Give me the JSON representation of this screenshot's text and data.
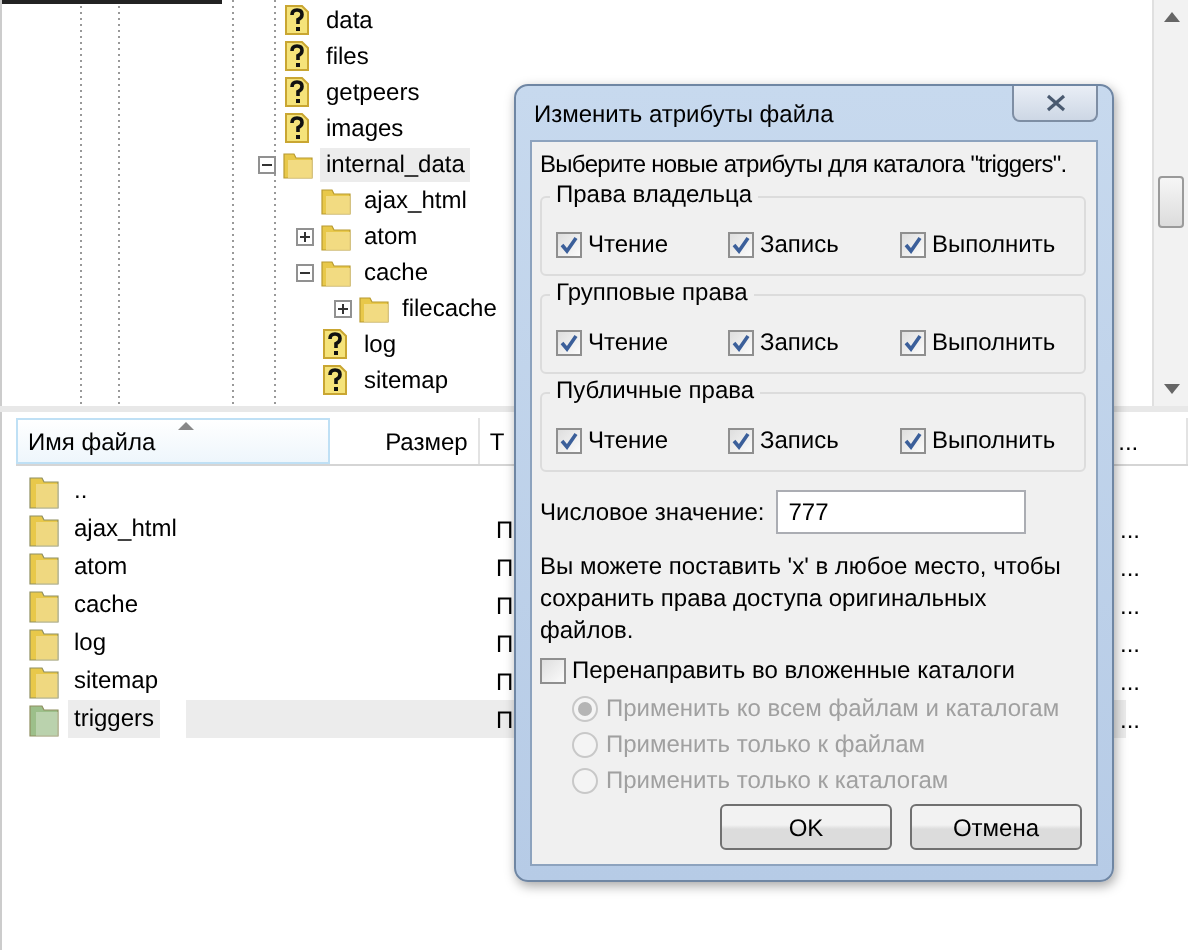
{
  "tree": [
    {
      "name": "data",
      "kind": "unknown"
    },
    {
      "name": "files",
      "kind": "unknown"
    },
    {
      "name": "getpeers",
      "kind": "unknown"
    },
    {
      "name": "images",
      "kind": "unknown"
    },
    {
      "name": "internal_data",
      "kind": "folder",
      "expanded": true,
      "selected": true,
      "children": [
        {
          "name": "ajax_html",
          "kind": "folder"
        },
        {
          "name": "atom",
          "kind": "folder",
          "expanded": false
        },
        {
          "name": "cache",
          "kind": "folder",
          "expanded": true,
          "children": [
            {
              "name": "filecache",
              "kind": "folder",
              "expanded": false
            }
          ]
        },
        {
          "name": "log",
          "kind": "unknown"
        },
        {
          "name": "sitemap",
          "kind": "unknown"
        }
      ]
    }
  ],
  "file_list": {
    "columns": [
      "Имя файла",
      "Размер",
      "Т",
      "..."
    ],
    "rows": [
      {
        "name": "..",
        "column_3": "",
        "column_4": "",
        "color": "#e8c84a",
        "selected": false
      },
      {
        "name": "ajax_html",
        "column_3": "П",
        "column_4": "...",
        "color": "#e8c84a",
        "selected": false
      },
      {
        "name": "atom",
        "column_3": "П",
        "column_4": "...",
        "color": "#e8c84a",
        "selected": false
      },
      {
        "name": "cache",
        "column_3": "П",
        "column_4": "...",
        "color": "#e8c84a",
        "selected": false
      },
      {
        "name": "log",
        "column_3": "П",
        "column_4": "...",
        "color": "#e8c84a",
        "selected": false
      },
      {
        "name": "sitemap",
        "column_3": "П",
        "column_4": "...",
        "color": "#e8c84a",
        "selected": false
      },
      {
        "name": "triggers",
        "column_3": "П",
        "column_4": "...",
        "color": "#9cbf8a",
        "selected": true
      }
    ]
  },
  "dialog": {
    "title": "Изменить атрибуты файла",
    "prompt": "Выберите новые атрибуты для каталога \"triggers\".",
    "groups": [
      {
        "title": "Права владельца",
        "options": [
          {
            "label": "Чтение",
            "checked": true
          },
          {
            "label": "Запись",
            "checked": true
          },
          {
            "label": "Выполнить",
            "checked": true
          }
        ]
      },
      {
        "title": "Групповые права",
        "options": [
          {
            "label": "Чтение",
            "checked": true
          },
          {
            "label": "Запись",
            "checked": true
          },
          {
            "label": "Выполнить",
            "checked": true
          }
        ]
      },
      {
        "title": "Публичные права",
        "options": [
          {
            "label": "Чтение",
            "checked": true
          },
          {
            "label": "Запись",
            "checked": true
          },
          {
            "label": "Выполнить",
            "checked": true
          }
        ]
      }
    ],
    "numeric_label": "Числовое значение:",
    "numeric_value": "777",
    "note": "Вы можете поставить 'x' в любое место, чтобы сохранить права доступа оригинальных файлов.",
    "recurse": {
      "label": "Перенаправить во вложенные каталоги",
      "checked": false
    },
    "apply_options": [
      {
        "label": "Применить ко всем файлам и каталогам",
        "selected": true,
        "disabled": true
      },
      {
        "label": "Применить только к файлам",
        "selected": false,
        "disabled": true
      },
      {
        "label": "Применить только к каталогам",
        "selected": false,
        "disabled": true
      }
    ],
    "buttons": [
      "OK",
      "Отмена"
    ]
  }
}
